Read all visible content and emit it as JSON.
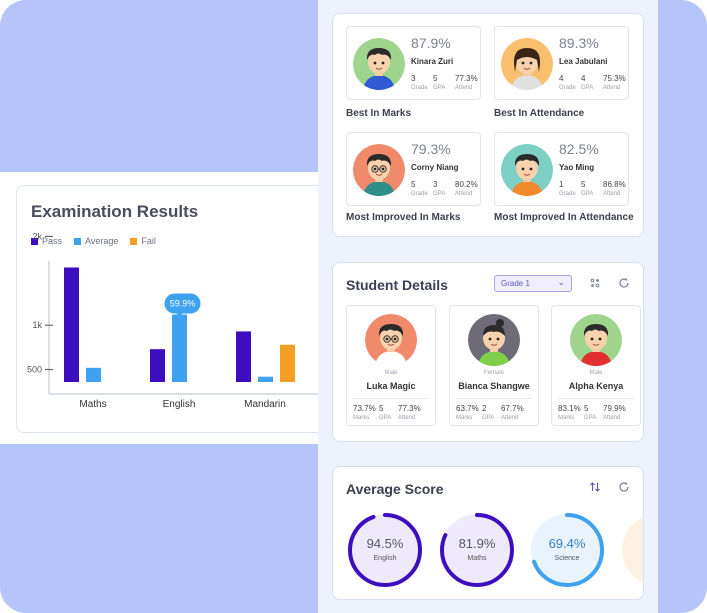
{
  "exam": {
    "title": "Examination Results",
    "tooltip": "59.9%",
    "legend": [
      {
        "label": "Pass",
        "color": "#3d0ebf"
      },
      {
        "label": "Average",
        "color": "#3ea2f0"
      },
      {
        "label": "Fail",
        "color": "#f4a025"
      }
    ]
  },
  "chart_data": {
    "type": "bar",
    "title": "Examination Results",
    "categories": [
      "Maths",
      "English",
      "Mandarin"
    ],
    "yticks": [
      "2k",
      "1k",
      "500"
    ],
    "series": [
      {
        "name": "Pass",
        "color": "#3d0ebf",
        "values": [
          1650,
          730,
          930
        ]
      },
      {
        "name": "Average",
        "color": "#3ea2f0",
        "values": [
          520,
          1120,
          420
        ]
      },
      {
        "name": "Fail",
        "color": "#f4a025",
        "values": [
          320,
          320,
          780
        ]
      }
    ],
    "highlight": {
      "category": "English",
      "series": "Average",
      "label": "59.9%"
    }
  },
  "awards": [
    {
      "pct": "87.9%",
      "name": "Kinara Zuri",
      "grade": "3",
      "gpa": "5",
      "attend": "77.3%",
      "caption": "Best In Marks",
      "avatar_bg": "#9fd48c"
    },
    {
      "pct": "89.3%",
      "name": "Lea Jabulani",
      "grade": "4",
      "gpa": "4",
      "attend": "75.3%",
      "caption": "Best In Attendance",
      "avatar_bg": "#f8c06e"
    },
    {
      "pct": "79.3%",
      "name": "Corny Niang",
      "grade": "5",
      "gpa": "3",
      "attend": "80.2%",
      "caption": "Most Improved In Marks",
      "avatar_bg": "#f08a6b"
    },
    {
      "pct": "82.5%",
      "name": "Yao Ming",
      "grade": "1",
      "gpa": "5",
      "attend": "86.8%",
      "caption": "Most Improved In Attendance",
      "avatar_bg": "#7ecfc4"
    }
  ],
  "labels": {
    "grade": "Grade",
    "gpa": "GPA",
    "attend": "Attend",
    "marks": "Marks"
  },
  "student_details": {
    "title": "Student Details",
    "grade_select": "Grade 1",
    "students": [
      {
        "gender": "Male",
        "name": "Luka Magic",
        "marks": "73.7%",
        "gpa": "5",
        "attend": "77.3%",
        "avatar_bg": "#f08a6b"
      },
      {
        "gender": "Female",
        "name": "Bianca Shangwe",
        "marks": "63.7%",
        "gpa": "2",
        "attend": "67.7%",
        "avatar_bg": "#6e6a78"
      },
      {
        "gender": "Male",
        "name": "Alpha Kenya",
        "marks": "83.1%",
        "gpa": "5",
        "attend": "79.9%",
        "avatar_bg": "#9fd48c"
      }
    ]
  },
  "average_score": {
    "title": "Average Score",
    "items": [
      {
        "value": "94.5%",
        "subject": "English",
        "percent": 94.5,
        "ring": "#3d0ebf",
        "fill": "#eee9fb",
        "text": "#555a6a"
      },
      {
        "value": "81.9%",
        "subject": "Maths",
        "percent": 81.9,
        "ring": "#3d0ebf",
        "fill": "#eee9fb",
        "text": "#555a6a"
      },
      {
        "value": "69.4%",
        "subject": "Science",
        "percent": 69.4,
        "ring": "#3ea2f0",
        "fill": "#e8f3fd",
        "text": "#3880c0"
      }
    ]
  }
}
